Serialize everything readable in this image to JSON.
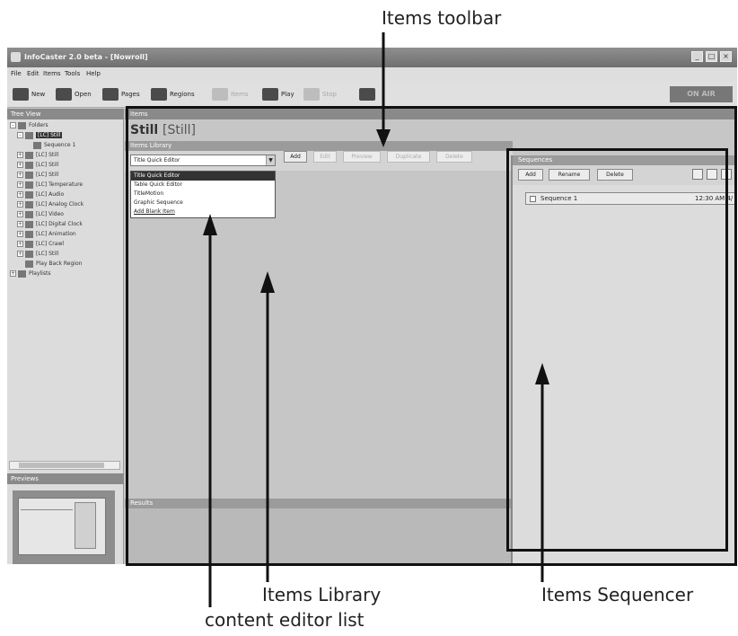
{
  "window": {
    "title": "InfoCaster 2.0 beta - [Nowroll]",
    "on_air_label": "ON AIR"
  },
  "menubar": [
    "File",
    "Edit",
    "Items",
    "Tools",
    "Help"
  ],
  "toolbar": {
    "buttons": [
      {
        "label": "New",
        "icon": "new-icon",
        "enabled": true
      },
      {
        "label": "Open",
        "icon": "open-folder-icon",
        "enabled": true
      },
      {
        "label": "Pages",
        "icon": "pages-icon",
        "enabled": true
      },
      {
        "label": "Regions",
        "icon": "regions-icon",
        "enabled": true
      },
      {
        "label": "Items",
        "icon": "items-icon",
        "enabled": false
      },
      {
        "label": "Play",
        "icon": "play-icon",
        "enabled": true
      },
      {
        "label": "Stop",
        "icon": "stop-icon",
        "enabled": false
      },
      {
        "label": "",
        "icon": "ticker-icon",
        "enabled": true
      }
    ]
  },
  "sidebar": {
    "tree_header": "Tree View",
    "tree": [
      {
        "label": "Folders",
        "depth": 0,
        "expander": "-"
      },
      {
        "label": "[LC] Still",
        "depth": 1,
        "expander": "-",
        "selected": true
      },
      {
        "label": "Sequence 1",
        "depth": 2,
        "expander": ""
      },
      {
        "label": "[LC] Still",
        "depth": 1,
        "expander": "+"
      },
      {
        "label": "[LC] Still",
        "depth": 1,
        "expander": "+"
      },
      {
        "label": "[LC] Still",
        "depth": 1,
        "expander": "+"
      },
      {
        "label": "[LC] Temperature",
        "depth": 1,
        "expander": "+"
      },
      {
        "label": "[LC] Audio",
        "depth": 1,
        "expander": "+"
      },
      {
        "label": "[LC] Analog Clock",
        "depth": 1,
        "expander": "+"
      },
      {
        "label": "[LC] Video",
        "depth": 1,
        "expander": "+"
      },
      {
        "label": "[LC] Digital Clock",
        "depth": 1,
        "expander": "+"
      },
      {
        "label": "[LC] Animation",
        "depth": 1,
        "expander": "+"
      },
      {
        "label": "[LC] Crawl",
        "depth": 1,
        "expander": "+"
      },
      {
        "label": "[LC] Still",
        "depth": 1,
        "expander": "+"
      },
      {
        "label": "Play Back Region",
        "depth": 1,
        "expander": ""
      },
      {
        "label": "Playlists",
        "depth": 0,
        "expander": "+"
      }
    ],
    "preview_header": "Previews"
  },
  "main": {
    "header": "Items",
    "item_title": "Still",
    "item_subtitle": "[Still]",
    "library": {
      "header": "Items Library",
      "editor_selected": "Title Quick Editor",
      "buttons": [
        {
          "label": "Add",
          "enabled": true
        },
        {
          "label": "Edit",
          "enabled": false
        },
        {
          "label": "Preview",
          "enabled": false
        },
        {
          "label": "Duplicate",
          "enabled": false
        },
        {
          "label": "Delete",
          "enabled": false
        }
      ],
      "editor_options": [
        "Title Quick Editor",
        "Table Quick Editor",
        "TitleMotion",
        "Graphic Sequence",
        "Add Blank Item"
      ]
    },
    "results_header": "Results"
  },
  "sequencer": {
    "header": "Sequences",
    "buttons": [
      "Add",
      "Rename",
      "Delete"
    ],
    "rows": [
      {
        "name": "Sequence 1",
        "time": "12:30 AM 4/"
      }
    ]
  },
  "callouts": {
    "items_toolbar": "Items toolbar",
    "items_library": "Items Library",
    "content_editor_list": "content editor list",
    "items_sequencer": "Items Sequencer"
  }
}
